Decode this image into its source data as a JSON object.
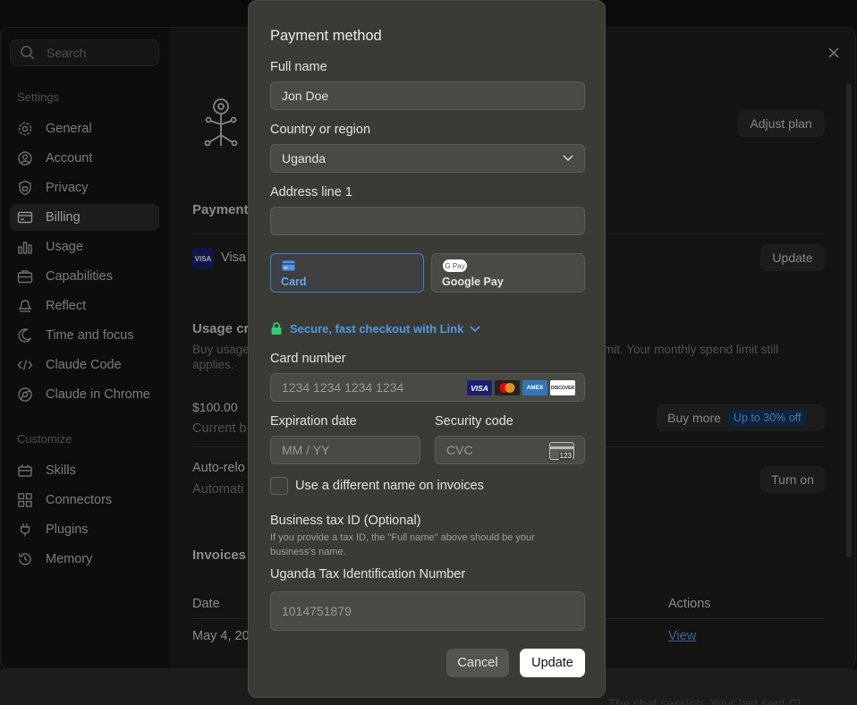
{
  "sidebar": {
    "search_placeholder": "Search",
    "settings_label": "Settings",
    "customize_label": "Customize",
    "settings_items": [
      {
        "label": "General",
        "icon": "gear-icon"
      },
      {
        "label": "Account",
        "icon": "user-circle-icon"
      },
      {
        "label": "Privacy",
        "icon": "shield-lock-icon"
      },
      {
        "label": "Billing",
        "icon": "credit-card-icon",
        "active": true
      },
      {
        "label": "Usage",
        "icon": "bar-chart-icon"
      },
      {
        "label": "Capabilities",
        "icon": "briefcase-icon"
      },
      {
        "label": "Reflect",
        "icon": "bell-icon"
      },
      {
        "label": "Time and focus",
        "icon": "moon-icon"
      },
      {
        "label": "Claude Code",
        "icon": "code-icon"
      },
      {
        "label": "Claude in Chrome",
        "icon": "globe-icon"
      }
    ],
    "customize_items": [
      {
        "label": "Skills",
        "icon": "tools-icon"
      },
      {
        "label": "Connectors",
        "icon": "grid-icon"
      },
      {
        "label": "Plugins",
        "icon": "plug-icon"
      },
      {
        "label": "Memory",
        "icon": "history-icon"
      }
    ]
  },
  "main": {
    "adjust_plan": "Adjust plan",
    "payment_heading": "Payment",
    "visa_text": "Visa",
    "visa_badge": "VISA",
    "update_label": "Update",
    "usage_heading": "Usage cr",
    "usage_desc_left": "Buy usage",
    "usage_desc_right": "mit. Your monthly spend limit still",
    "usage_desc_line2": "applies.",
    "amount": "$100.00",
    "current_balance": "Current b",
    "buy_more": "Buy more",
    "discount_badge": "Up to 30% off",
    "auto_reload": "Auto-relo",
    "automatic": "Automati",
    "turn_on": "Turn on",
    "invoices_heading": "Invoices",
    "date_col": "Date",
    "actions_col": "Actions",
    "first_date": "May 4, 20",
    "view_link": "View"
  },
  "background_text": "The chat session. Your last sent Cl",
  "modal": {
    "title": "Payment method",
    "full_name_label": "Full name",
    "full_name_value": "Jon Doe",
    "country_label": "Country or region",
    "country_value": "Uganda",
    "address_label": "Address line 1",
    "address_value": "",
    "tab_card": "Card",
    "tab_gpay": "Google Pay",
    "gpay_badge": "G Pay",
    "link_text": "Secure, fast checkout with Link",
    "card_number_label": "Card number",
    "card_number_placeholder": "1234 1234 1234 1234",
    "card_logos": [
      "VISA",
      "MC",
      "AMEX",
      "DISCOVER"
    ],
    "expiration_label": "Expiration date",
    "expiration_placeholder": "MM / YY",
    "security_label": "Security code",
    "security_placeholder": "CVC",
    "cvc_icon_text": "123",
    "different_name_label": "Use a different name on invoices",
    "tax_id_label": "Business tax ID (Optional)",
    "tax_help": "If you provide a tax ID, the \"Full name\" above should be your business's name.",
    "tin_label": "Uganda Tax Identification Number",
    "tin_placeholder": "1014751879",
    "cancel_label": "Cancel",
    "update_label": "Update"
  },
  "colors": {
    "accent_blue": "#3f7fd6",
    "link_green": "#2ecc71",
    "link_blue": "#4d9ae8"
  }
}
